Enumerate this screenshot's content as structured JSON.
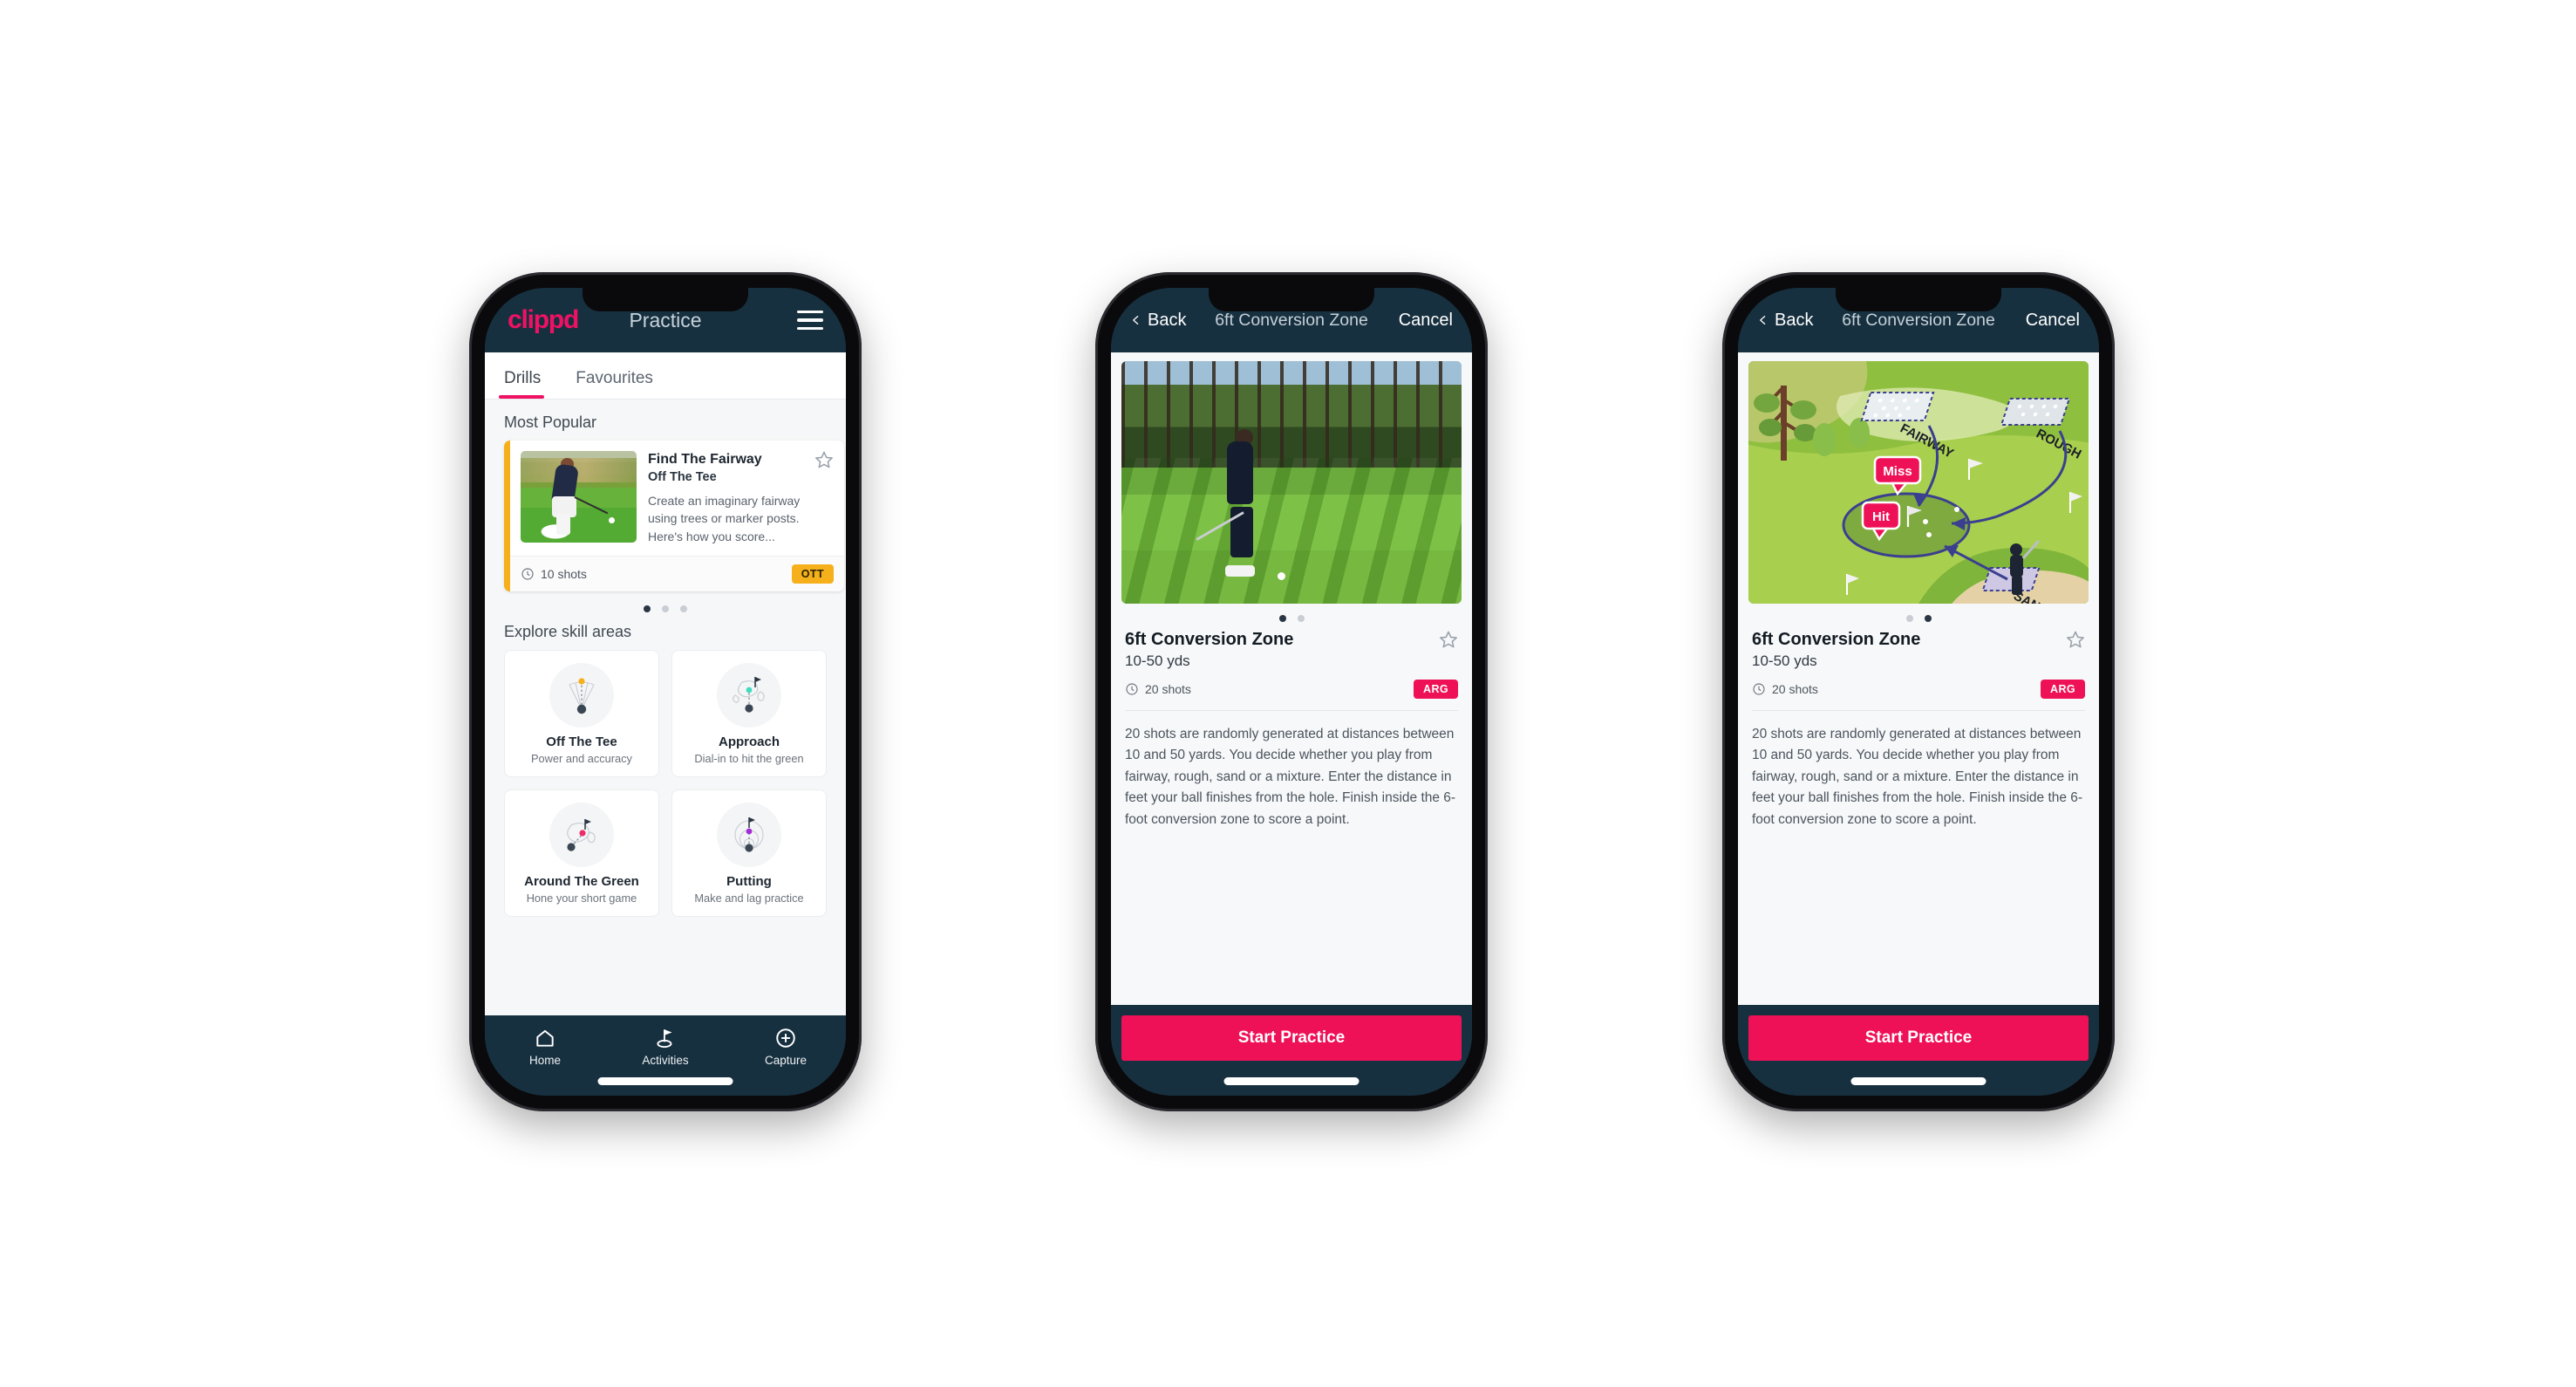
{
  "app": {
    "brand": "clippd",
    "accent_pink": "#ef1164",
    "accent_yellow": "#f5b01b",
    "accent_teal": "#3fdcc0",
    "header_navy": "#17303f"
  },
  "phone1": {
    "header": {
      "logo": "clippd",
      "title": "Practice",
      "menu_icon": "hamburger-icon"
    },
    "tabs": [
      {
        "label": "Drills",
        "active": true
      },
      {
        "label": "Favourites",
        "active": false
      }
    ],
    "most_popular": {
      "section_label": "Most Popular",
      "card": {
        "title": "Find The Fairway",
        "subtitle": "Off The Tee",
        "description": "Create an imaginary fairway using trees or marker posts. Here's how you score...",
        "shots": "10 shots",
        "badge": "OTT",
        "accent": "#f5b01b",
        "favourite_icon": "star-outline-icon",
        "shots_icon": "clock-icon"
      },
      "next_card_accent": "#3fdcc0",
      "dots": [
        true,
        false,
        false
      ]
    },
    "skills": {
      "section_label": "Explore skill areas",
      "items": [
        {
          "name": "Off The Tee",
          "desc": "Power and accuracy",
          "icon": "tee-fan-icon",
          "dot_color": "#f5b01b"
        },
        {
          "name": "Approach",
          "desc": "Dial-in to hit the green",
          "icon": "green-approach-icon",
          "dot_color": "#3fdcc0"
        },
        {
          "name": "Around The Green",
          "desc": "Hone your short game",
          "icon": "chip-green-icon",
          "dot_color": "#ef2c6b"
        },
        {
          "name": "Putting",
          "desc": "Make and lag practice",
          "icon": "putting-rings-icon",
          "dot_color": "#a32bd6"
        }
      ]
    },
    "nav": [
      {
        "label": "Home",
        "icon": "home-icon"
      },
      {
        "label": "Activities",
        "icon": "golf-flag-icon"
      },
      {
        "label": "Capture",
        "icon": "plus-circle-icon"
      }
    ]
  },
  "phone2": {
    "header": {
      "back": "Back",
      "title": "6ft Conversion Zone",
      "cancel": "Cancel",
      "back_icon": "chevron-left-icon"
    },
    "media_type": "photo-golfer-chipping",
    "dots": [
      true,
      false
    ],
    "detail": {
      "name": "6ft Conversion Zone",
      "yards": "10-50 yds",
      "shots": "20 shots",
      "badge": "ARG",
      "favourite_icon": "star-outline-icon",
      "shots_icon": "clock-icon",
      "description": "20 shots are randomly generated at distances between 10 and 50 yards. You decide whether you play from fairway, rough, sand or a mixture. Enter the distance in feet your ball finishes from the hole. Finish inside the 6-foot conversion zone to score a point."
    },
    "start_button": "Start Practice"
  },
  "phone3": {
    "header": {
      "back": "Back",
      "title": "6ft Conversion Zone",
      "cancel": "Cancel",
      "back_icon": "chevron-left-icon"
    },
    "media_type": "illustration-course-map",
    "illustration": {
      "labels": [
        {
          "text": "FAIRWAY"
        },
        {
          "text": "ROUGH"
        },
        {
          "text": "SAND"
        }
      ],
      "markers": [
        {
          "text": "Miss",
          "color": "#ef1157"
        },
        {
          "text": "Hit",
          "color": "#ef1157"
        }
      ]
    },
    "dots": [
      false,
      true
    ],
    "detail": {
      "name": "6ft Conversion Zone",
      "yards": "10-50 yds",
      "shots": "20 shots",
      "badge": "ARG",
      "favourite_icon": "star-outline-icon",
      "shots_icon": "clock-icon",
      "description": "20 shots are randomly generated at distances between 10 and 50 yards. You decide whether you play from fairway, rough, sand or a mixture. Enter the distance in feet your ball finishes from the hole. Finish inside the 6-foot conversion zone to score a point."
    },
    "start_button": "Start Practice"
  }
}
